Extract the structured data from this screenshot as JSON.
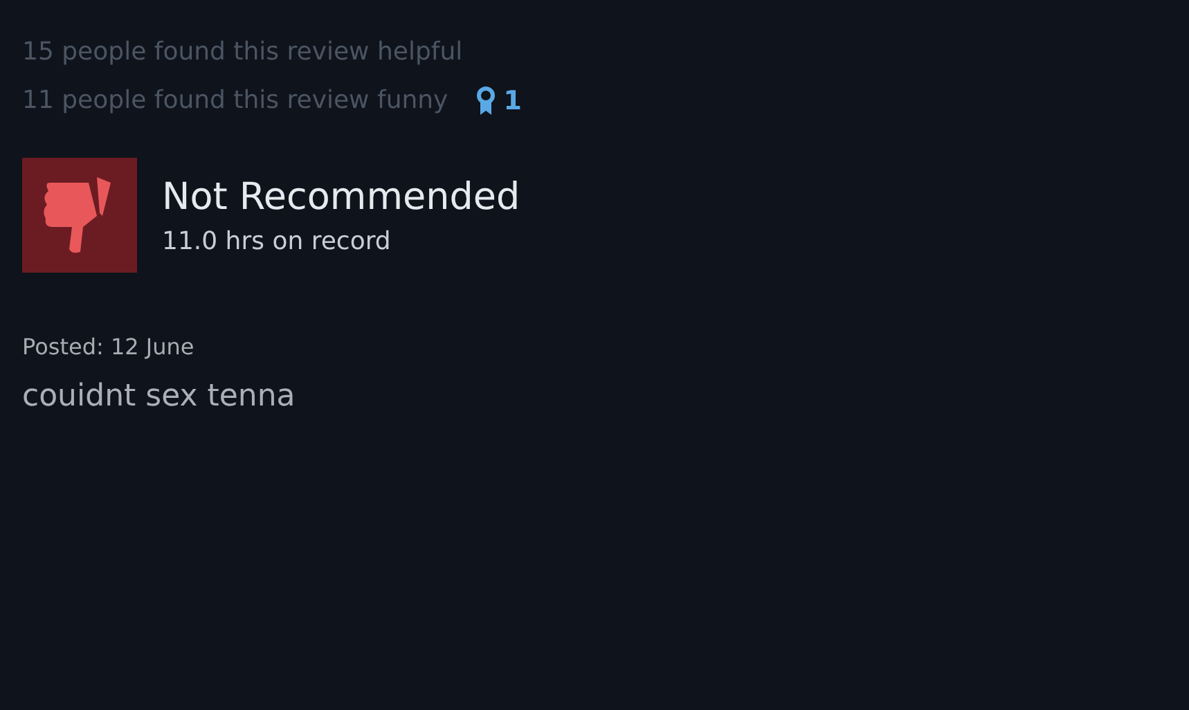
{
  "review": {
    "helpful": "15 people found this review helpful",
    "funny": "11 people found this review funny",
    "awards": "1",
    "recommended": false,
    "verdict": "Not Recommended",
    "hours": "11.0 hrs on record",
    "posted": "Posted: 12 June",
    "body": "couidnt sex tenna"
  }
}
